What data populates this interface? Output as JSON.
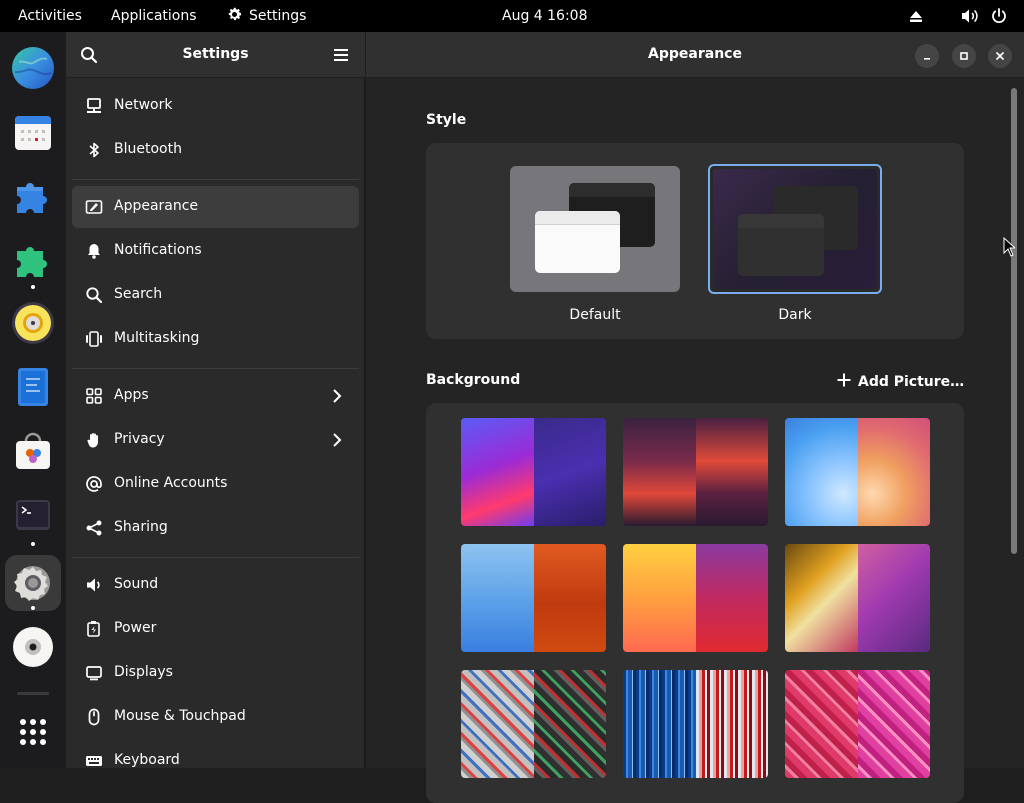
{
  "topbar": {
    "activities": "Activities",
    "applications": "Applications",
    "settings_menu": "Settings",
    "clock": "Aug 4  16:08"
  },
  "dock": {
    "apps": [
      "web-browser",
      "calendar",
      "extensions",
      "extension-manager",
      "rhythmbox",
      "text-editor",
      "software",
      "terminal",
      "settings",
      "disks",
      "show-apps"
    ]
  },
  "sidebar": {
    "title": "Settings",
    "items": [
      {
        "label": "Network",
        "icon": "network-icon"
      },
      {
        "label": "Bluetooth",
        "icon": "bluetooth-icon"
      },
      {
        "label": "Appearance",
        "icon": "appearance-icon",
        "active": true
      },
      {
        "label": "Notifications",
        "icon": "bell-icon"
      },
      {
        "label": "Search",
        "icon": "search-icon"
      },
      {
        "label": "Multitasking",
        "icon": "multitasking-icon"
      },
      {
        "label": "Apps",
        "icon": "apps-icon",
        "chevron": true
      },
      {
        "label": "Privacy",
        "icon": "hand-icon",
        "chevron": true
      },
      {
        "label": "Online Accounts",
        "icon": "at-icon"
      },
      {
        "label": "Sharing",
        "icon": "share-icon"
      },
      {
        "label": "Sound",
        "icon": "speaker-icon"
      },
      {
        "label": "Power",
        "icon": "power-plug-icon"
      },
      {
        "label": "Displays",
        "icon": "display-icon"
      },
      {
        "label": "Mouse & Touchpad",
        "icon": "mouse-icon"
      },
      {
        "label": "Keyboard",
        "icon": "keyboard-icon"
      }
    ]
  },
  "main": {
    "title": "Appearance",
    "style_section": {
      "title": "Style",
      "options": [
        {
          "label": "Default",
          "selected": false
        },
        {
          "label": "Dark",
          "selected": true
        }
      ]
    },
    "background_section": {
      "title": "Background",
      "add_picture": "Add Picture…"
    }
  },
  "colors": {
    "accent": "#78aeed",
    "sidebar_bg": "#2a2a2a",
    "content_bg": "#242424",
    "card_bg": "#303030",
    "topbar_bg": "#000000"
  }
}
